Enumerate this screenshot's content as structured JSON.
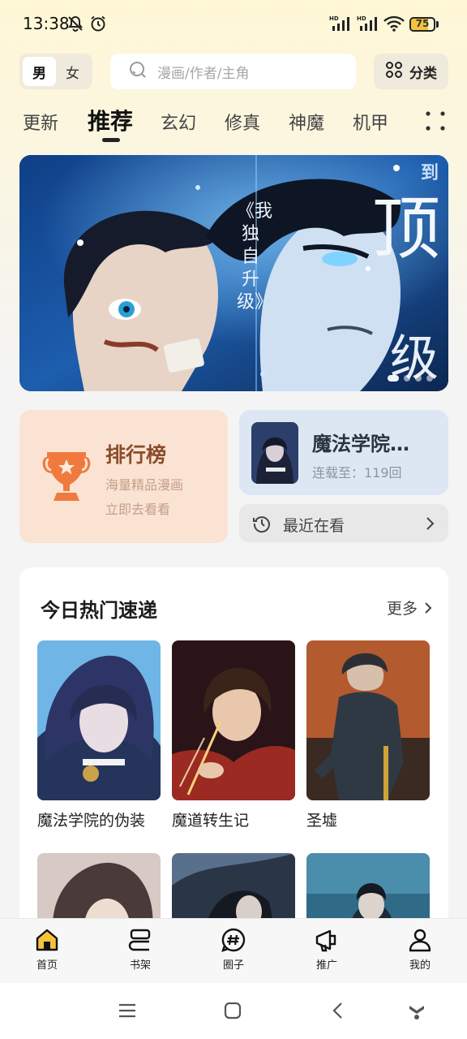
{
  "status_bar": {
    "time": "13:38",
    "battery": "75",
    "battery_level": 0.75
  },
  "header": {
    "gender": [
      "男",
      "女"
    ],
    "search_placeholder": "漫画/作者/主角",
    "category_label": "分类"
  },
  "tabs": [
    "更新",
    "推荐",
    "玄幻",
    "修真",
    "神魔",
    "机甲"
  ],
  "banner": {
    "corner_text": "到",
    "big_text_1": "顶",
    "big_text_2": "级",
    "vertical_title": "《我独自升级》"
  },
  "ranking": {
    "title": "排行榜",
    "subtitle_1": "海量精品漫画",
    "subtitle_2": "立即去看看"
  },
  "continue_reading": {
    "title": "魔法学院…",
    "progress": "连载至：119回"
  },
  "recent": {
    "label": "最近在看"
  },
  "hot": {
    "title": "今日热门速递",
    "more_label": "更多",
    "comics": [
      {
        "title": "魔法学院的伪装"
      },
      {
        "title": "魔道转生记"
      },
      {
        "title": "圣墟"
      }
    ]
  },
  "bottom_nav": [
    "首页",
    "书架",
    "圈子",
    "推广",
    "我的"
  ],
  "colors": {
    "accent_yellow": "#f5c33b",
    "rank_bg": "#fbe3d3",
    "continue_bg": "#dde7f3"
  }
}
